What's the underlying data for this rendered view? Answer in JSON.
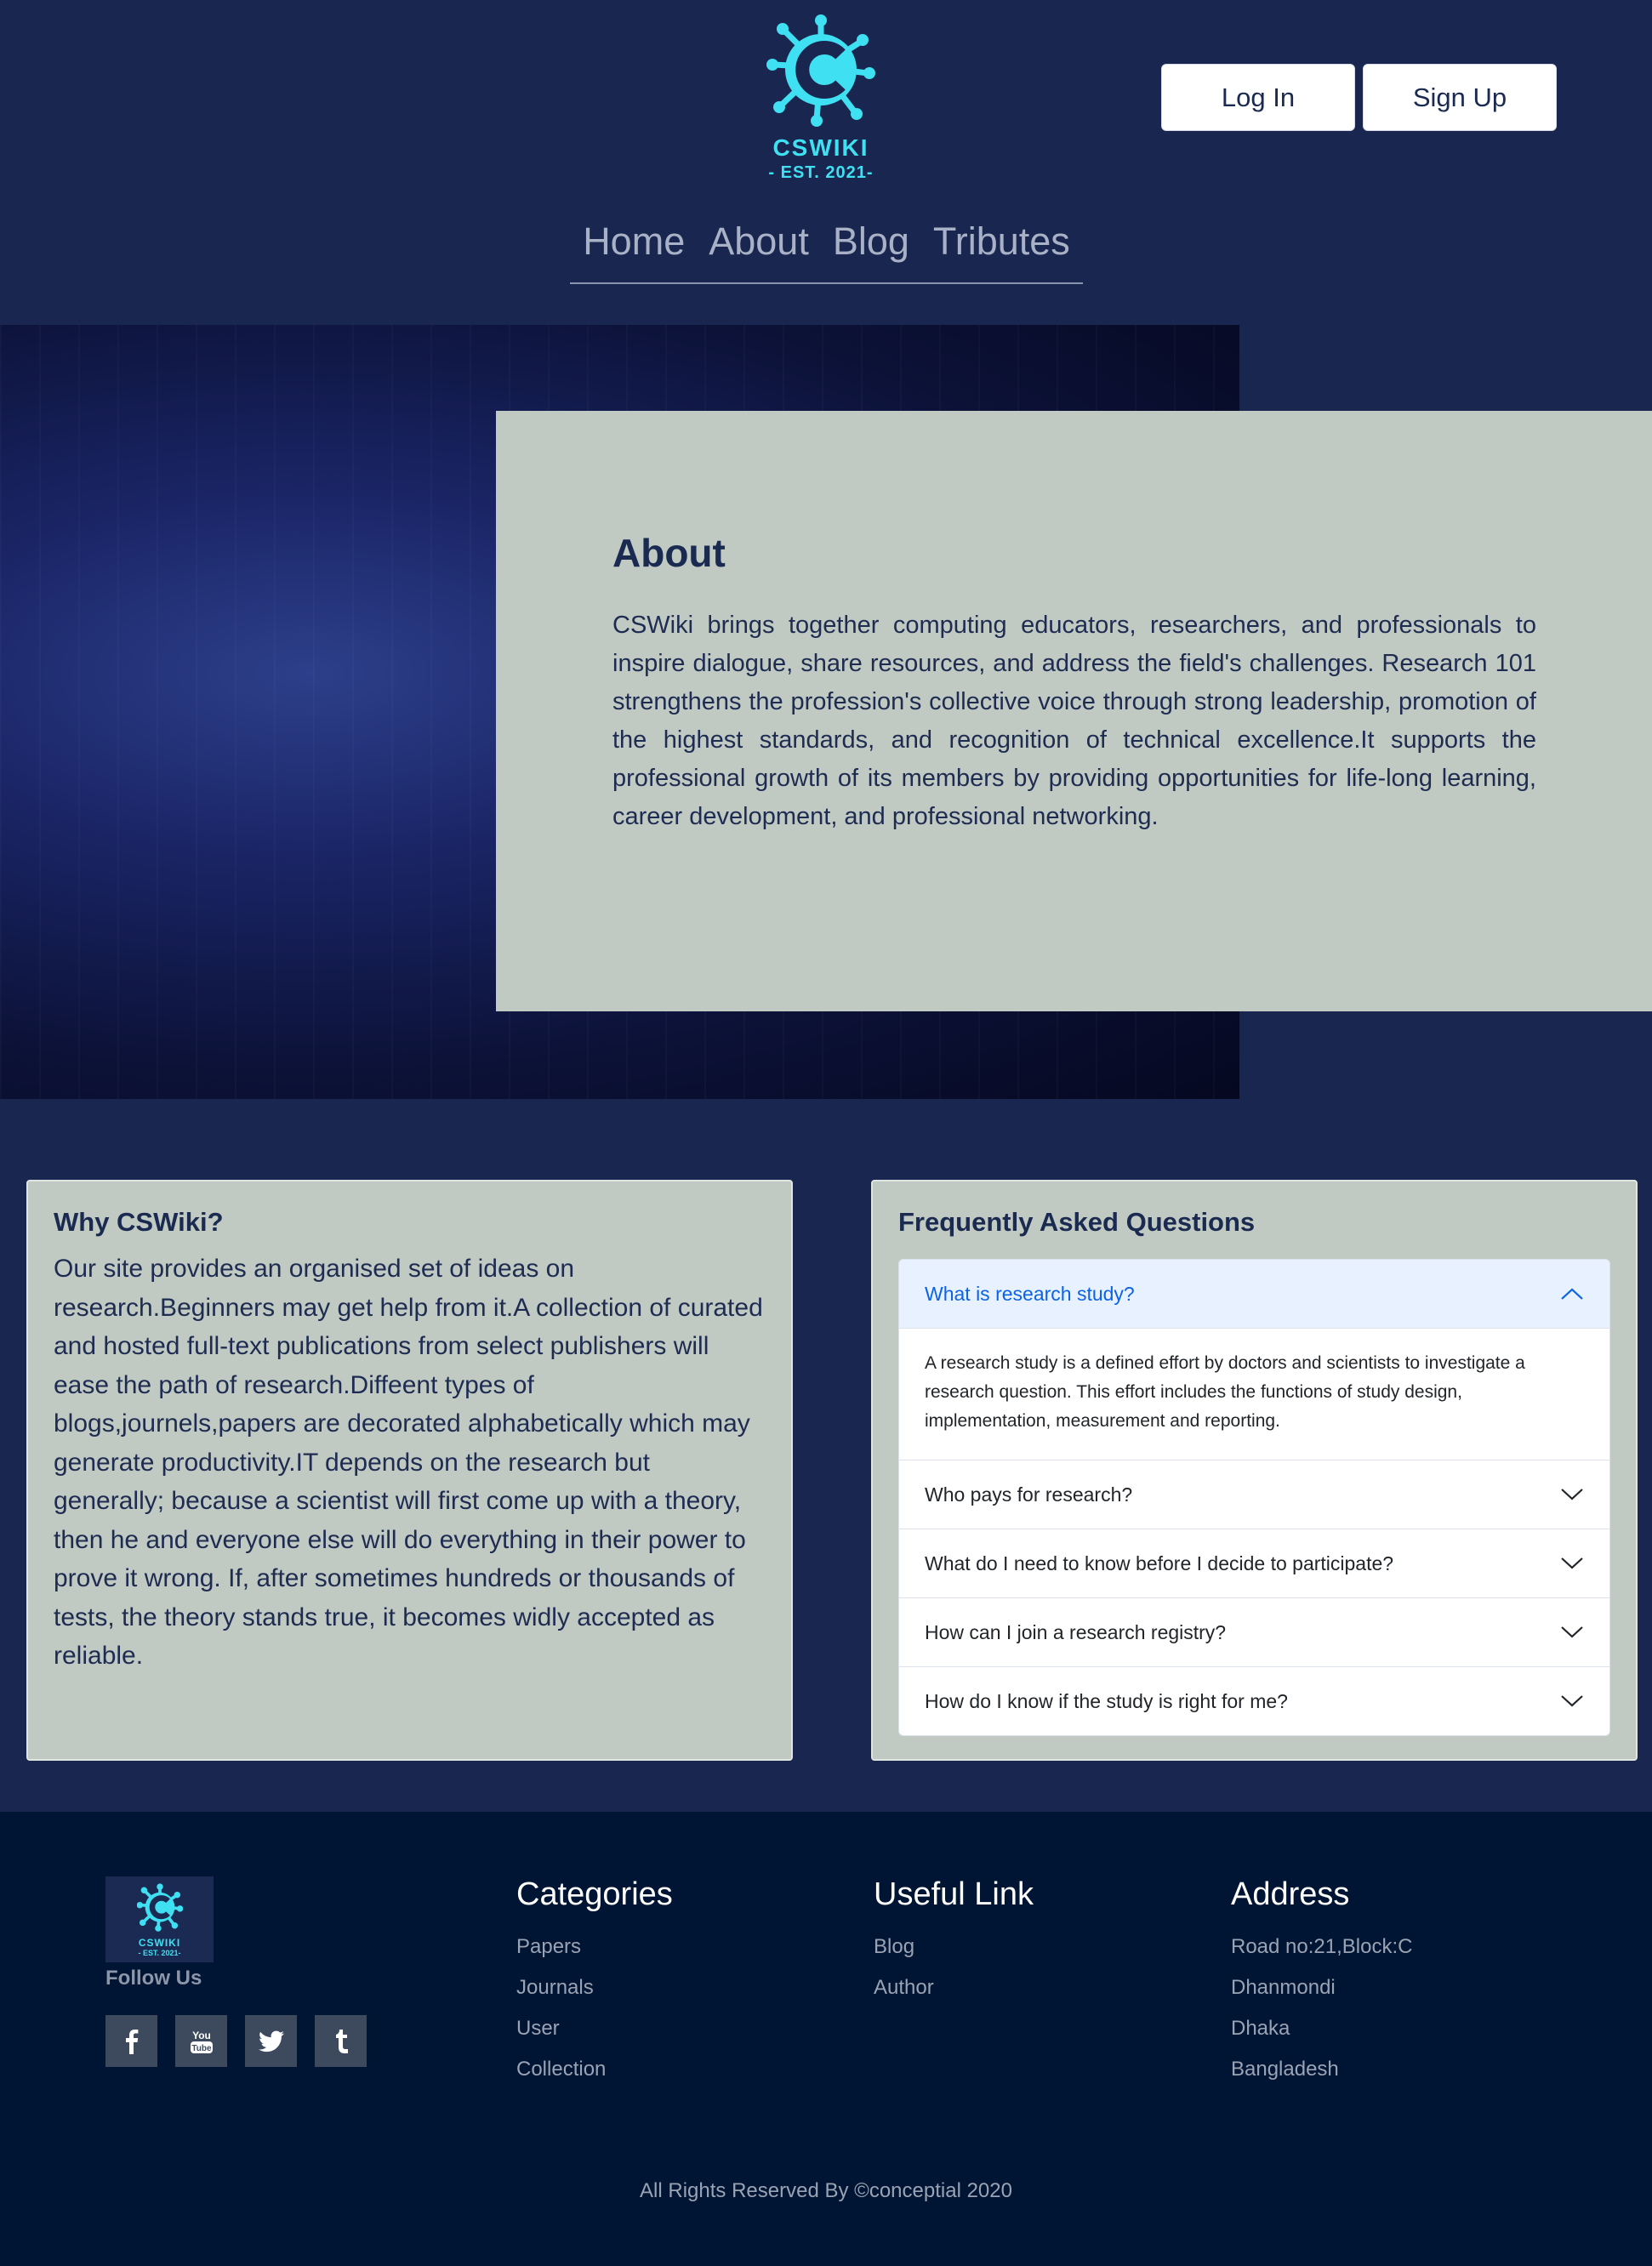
{
  "header": {
    "logo": {
      "name": "CSWIKI",
      "est": "- EST. 2021-",
      "icon": "virus-c-logo-icon",
      "color": "#3fe0f2"
    },
    "auth": {
      "login_label": "Log In",
      "signup_label": "Sign Up"
    },
    "nav": [
      {
        "label": "Home"
      },
      {
        "label": "About"
      },
      {
        "label": "Blog"
      },
      {
        "label": "Tributes"
      }
    ]
  },
  "about": {
    "title": "About",
    "text": "CSWiki brings together computing educators, researchers, and professionals to inspire dialogue, share resources, and address the field's challenges. Research 101 strengthens the profession's collective voice through strong leadership, promotion of the highest standards, and recognition of technical excellence.It supports the professional growth of its members by providing opportunities for life-long learning, career development, and professional networking."
  },
  "why": {
    "title": "Why CSWiki?",
    "text": "Our site provides an organised set of ideas on research.Beginners may get help from it.A collection of curated and hosted full-text publications from select publishers will ease the path of research.Diffeent types of blogs,journels,papers are decorated alphabetically which may generate productivity.IT depends on the research but generally; because a scientist will first come up with a theory, then he and everyone else will do everything in their power to prove it wrong. If, after sometimes hundreds or thousands of tests, the theory stands true, it becomes widly accepted as reliable."
  },
  "faq": {
    "title": "Frequently Asked Questions",
    "items": [
      {
        "question": "What is research study?",
        "answer": "A research study is a defined effort by doctors and scientists to investigate a research question. This effort includes the functions of study design, implementation, measurement and reporting.",
        "open": true
      },
      {
        "question": "Who pays for research?",
        "open": false
      },
      {
        "question": "What do I need to know before I decide to participate?",
        "open": false
      },
      {
        "question": "How can I join a research registry?",
        "open": false
      },
      {
        "question": "How do I know if the study is right for me?",
        "open": false
      }
    ]
  },
  "footer": {
    "logo": {
      "name": "CSWIKI",
      "est": "- EST. 2021-"
    },
    "follow_label": "Follow Us",
    "socials": [
      {
        "icon": "facebook-icon",
        "glyph": "f"
      },
      {
        "icon": "youtube-icon",
        "glyph": "You Tube"
      },
      {
        "icon": "twitter-icon",
        "glyph": "t"
      },
      {
        "icon": "tumblr-icon",
        "glyph": "t"
      }
    ],
    "categories": {
      "title": "Categories",
      "links": [
        "Papers",
        "Journals",
        "User",
        "Collection"
      ]
    },
    "useful": {
      "title": "Useful Link",
      "links": [
        "Blog",
        "Author"
      ]
    },
    "address": {
      "title": "Address",
      "lines": [
        "Road no:21,Block:C",
        "Dhanmondi",
        "Dhaka",
        "Bangladesh"
      ]
    },
    "copyright": "All Rights Reserved By ©conceptial 2020"
  },
  "colors": {
    "page_bg": "#182650",
    "card_bg": "#c0c9c2",
    "footer_bg": "#001533",
    "accent": "#3fe0f2",
    "faq_open": "#0c63e4"
  }
}
